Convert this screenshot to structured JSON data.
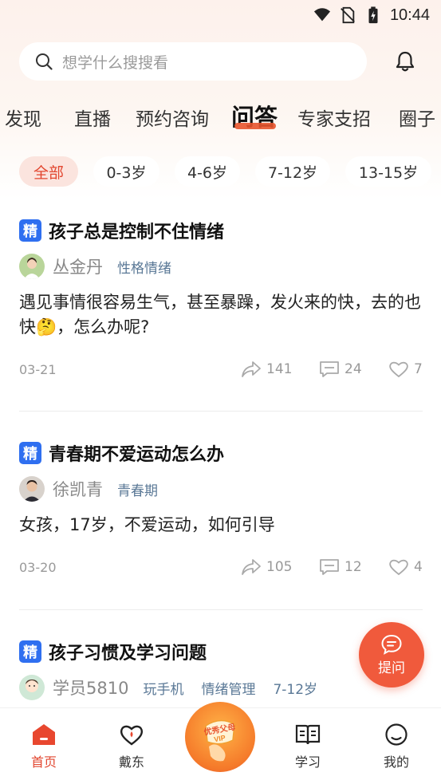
{
  "status_bar": {
    "time": "10:44"
  },
  "search": {
    "placeholder": "想学什么搜搜看"
  },
  "tabs": [
    "发现",
    "直播",
    "预约咨询",
    "问答",
    "专家支招",
    "圈子"
  ],
  "active_tab": "问答",
  "chips": [
    "全部",
    "0-3岁",
    "4-6岁",
    "7-12岁",
    "13-15岁"
  ],
  "posts": [
    {
      "badge": "精",
      "title": "孩子总是控制不住情绪",
      "author": "丛金丹",
      "tags": [
        "性格情绪"
      ],
      "body_part1": "遇见事情很容易生气，甚至暴躁，发火来的快，去的也快",
      "body_emoji": "🤔",
      "body_part2": "，怎么办呢?",
      "date": "03-21",
      "shares": "141",
      "comments": "24",
      "likes": "7"
    },
    {
      "badge": "精",
      "title": "青春期不爱运动怎么办",
      "author": "徐凯青",
      "tags": [
        "青春期"
      ],
      "body": "女孩，17岁，不爱运动，如何引导",
      "date": "03-20",
      "shares": "105",
      "comments": "12",
      "likes": "4"
    },
    {
      "badge": "精",
      "title": "孩子习惯及学习问题",
      "author": "学员5810",
      "tags": [
        "玩手机",
        "情绪管理",
        "7-12岁"
      ]
    }
  ],
  "fab": {
    "label": "提问"
  },
  "bottom_nav": [
    {
      "label": "首页",
      "icon": "home-icon",
      "active": true
    },
    {
      "label": "戴东",
      "icon": "heart-drop-icon",
      "active": false
    },
    {
      "label": "",
      "icon": "vip-badge-icon",
      "active": false
    },
    {
      "label": "学习",
      "icon": "book-icon",
      "active": false
    },
    {
      "label": "我的",
      "icon": "profile-face-icon",
      "active": false
    }
  ],
  "vip_badge_text": "优秀父母 VIP",
  "colors": {
    "accent": "#e2462f",
    "badge_blue": "#2f6ff0",
    "tag_blue": "#5a7896"
  }
}
